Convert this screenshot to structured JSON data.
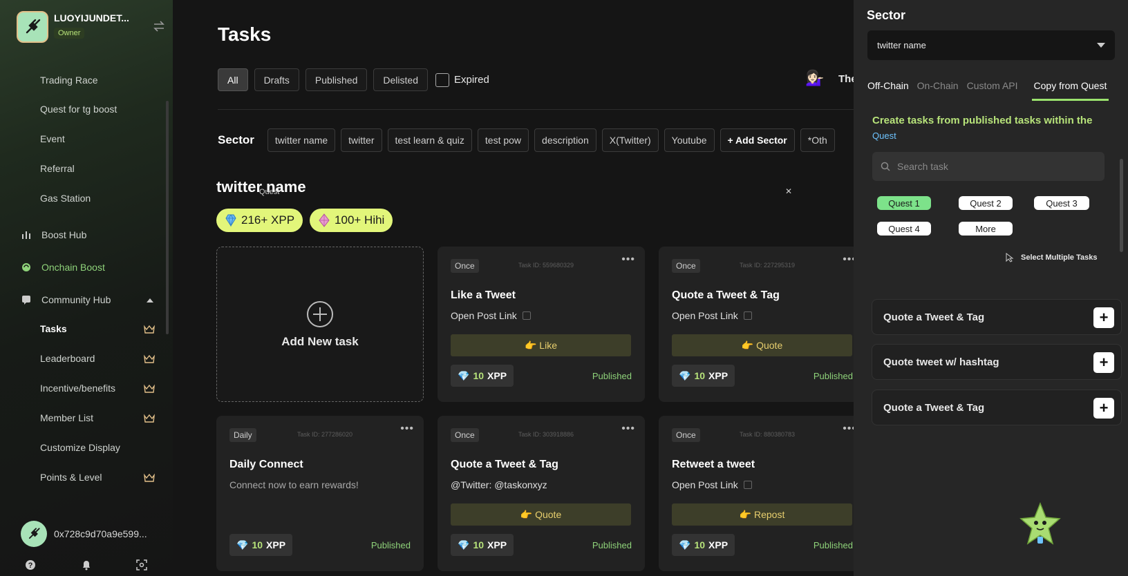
{
  "sidebar": {
    "brand_name": "LUOYIJUNDET...",
    "role": "Owner",
    "items": [
      {
        "label": "Trading Race"
      },
      {
        "label": "Quest for tg boost"
      },
      {
        "label": "Event"
      },
      {
        "label": "Referral"
      },
      {
        "label": "Gas Station"
      }
    ],
    "groups": {
      "boost_hub": "Boost Hub",
      "onchain_boost": "Onchain Boost",
      "community_hub": "Community Hub"
    },
    "community_items": [
      {
        "label": "Tasks",
        "crown": true,
        "active": true
      },
      {
        "label": "Leaderboard",
        "crown": true
      },
      {
        "label": "Incentive/benefits",
        "crown": true
      },
      {
        "label": "Member List",
        "crown": true
      },
      {
        "label": "Customize Display",
        "crown": false
      },
      {
        "label": "Points & Level",
        "crown": true
      }
    ],
    "wallet_address": "0x728c9d70a9e599..."
  },
  "main": {
    "title": "Tasks",
    "filters": [
      "All",
      "Drafts",
      "Published",
      "Delisted"
    ],
    "active_filter": "All",
    "expired_label": "Expired",
    "topright_text": "The",
    "sector_label": "Sector",
    "sectors": [
      "twitter name",
      "twitter",
      "test learn & quiz",
      "test pow",
      "description",
      "X(Twitter)",
      "Youtube"
    ],
    "add_sector": "+ Add Sector",
    "other_sector": "*Oth",
    "section_title": "twitter name",
    "ghost_text": "Quest",
    "rewards": [
      {
        "label": "216+ XPP",
        "icon": "diamond-blue"
      },
      {
        "label": "100+ Hihi",
        "icon": "diamond-pink"
      }
    ],
    "add_new_task": "Add New task",
    "cards": [
      {
        "freq": "Once",
        "task_id": "Task ID: 559680329",
        "title": "Like a Tweet",
        "sub": "Open Post Link",
        "sub_copy": true,
        "action": "👉 Like",
        "points": "10",
        "unit": "XPP",
        "status": "Published"
      },
      {
        "freq": "Once",
        "task_id": "Task ID: 227295319",
        "title": "Quote a Tweet & Tag",
        "sub": "Open Post Link",
        "sub_copy": true,
        "action": "👉 Quote",
        "points": "10",
        "unit": "XPP",
        "status": "Published"
      },
      {
        "freq": "Daily",
        "task_id": "Task ID: 277286020",
        "title": "Daily Connect",
        "sub": "Connect now to earn rewards!",
        "sub_copy": false,
        "action": "",
        "points": "10",
        "unit": "XPP",
        "status": "Published"
      },
      {
        "freq": "Once",
        "task_id": "Task ID: 303918886",
        "title": "Quote a Tweet & Tag",
        "sub": "@Twitter: @taskonxyz",
        "sub_copy": false,
        "action": "👉 Quote",
        "points": "10",
        "unit": "XPP",
        "status": "Published"
      },
      {
        "freq": "Once",
        "task_id": "Task ID: 880380783",
        "title": "Retweet a tweet",
        "sub": "Open Post Link",
        "sub_copy": true,
        "action": "👉 Repost",
        "points": "10",
        "unit": "XPP",
        "status": "Published"
      }
    ]
  },
  "panel": {
    "title": "Sector",
    "select_value": "twitter name",
    "tabs": [
      "Off-Chain",
      "On-Chain",
      "Custom API",
      "Copy from Quest"
    ],
    "active_tab": "Copy from Quest",
    "headline": "Create tasks from published tasks within the",
    "headline_quest": "Quest",
    "search_placeholder": "Search task",
    "quests": [
      "Quest 1",
      "Quest 2",
      "Quest 3",
      "Quest 4",
      "More"
    ],
    "selected_quest": "Quest 1",
    "select_multiple": "Select Multiple Tasks",
    "task_list": [
      "Quote a Tweet & Tag",
      "Quote tweet w/ hashtag",
      "Quote a Tweet & Tag"
    ]
  },
  "colors": {
    "accent_green": "#b7e37a",
    "reward_yellow": "#e2f67a",
    "published_green": "#8fd37a",
    "action_bg": "#3d3e29",
    "action_text": "#e8cf6e"
  }
}
